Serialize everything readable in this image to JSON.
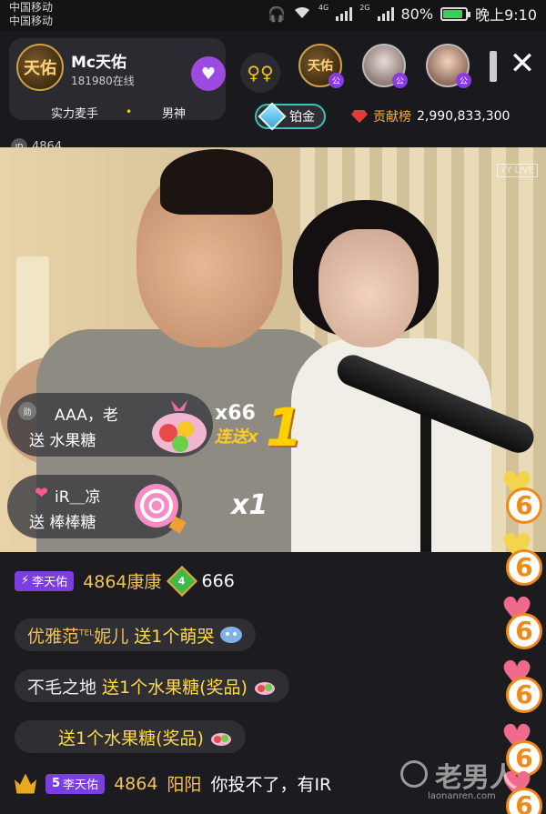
{
  "status_bar": {
    "carrier_1": "中国移动",
    "carrier_2": "中国移动",
    "net_1": "4G",
    "net_2": "2G",
    "battery_pct": "80%",
    "battery_level": 0.8,
    "time": "晚上9:10"
  },
  "anchor": {
    "avatar_text": "天佑",
    "name": "Mc天佑",
    "online": "181980在线",
    "tag_1": "实力麦手",
    "dot": "•",
    "tag_2": "男神"
  },
  "header": {
    "level_label": "铂金",
    "contrib_label": "贡献榜",
    "contrib_value": "2,990,833,300",
    "room_id_tag": "ID",
    "room_id": "4864",
    "viewer_avatar_1": "天佑",
    "viewer_badge": "公",
    "close": "✕",
    "camera_watermark": "YY LIVE"
  },
  "gifts": [
    {
      "badge": "勋",
      "user": "AAA，老",
      "action": "送 水果糖",
      "count": "x66",
      "combo": "连送x",
      "combo_num": "1"
    },
    {
      "user": "iR＿凉",
      "action": "送 棒棒糖",
      "count": "x1"
    }
  ],
  "chat": {
    "row1": {
      "badge_num": "",
      "badge_name": "李天佑",
      "user": "4864康康",
      "medal": "4",
      "msg": "666"
    },
    "row2": {
      "user": "优雅范",
      "tag": "TEL",
      "user_tail": "妮儿",
      "msg": "送1个萌哭"
    },
    "row3": {
      "user": "不毛之地",
      "msg": "送1个水果糖(奖品)"
    },
    "row4": {
      "msg": "送1个水果糖(奖品)"
    },
    "row5": {
      "badge_num": "5",
      "badge_name": "李天佑",
      "user": "4864",
      "user2": "阳阳",
      "msg": "你投不了，有IR"
    }
  },
  "hearts": {
    "six": "6",
    "colors": [
      "#f3d44a",
      "#f3d44a",
      "#f06a8c",
      "#f06a8c",
      "#f06a8c",
      "#f06a8c"
    ]
  },
  "watermark": {
    "cn": "老男人",
    "url": "laonanren.com"
  }
}
